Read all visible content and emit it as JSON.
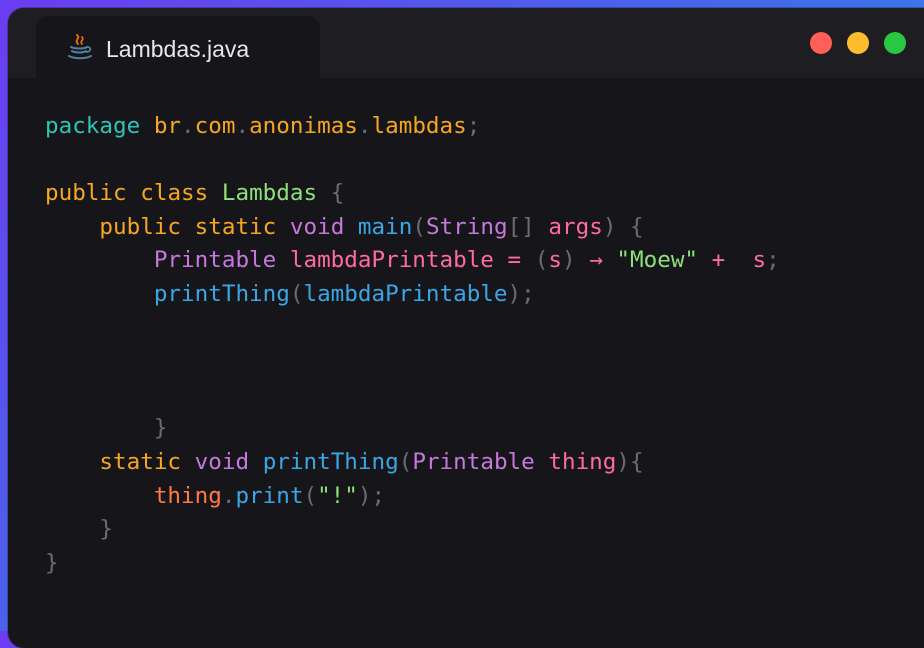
{
  "editor": {
    "tab": {
      "filename": "Lambdas.java",
      "icon": "java-icon"
    },
    "window_controls": [
      {
        "name": "close-dot",
        "color": "#ff5f57"
      },
      {
        "name": "minimize-dot",
        "color": "#febc2e"
      },
      {
        "name": "maximize-dot",
        "color": "#28c840"
      }
    ],
    "colors": {
      "background": "#16161a",
      "titlebar": "#1e1e22",
      "keyword": "#f5a623",
      "package_keyword": "#2ec4b6",
      "type": "#c678dd",
      "identifier": "#3aa6e6",
      "variable": "#ff6b9a",
      "string": "#8ee07a",
      "punctuation": "#6b6b75"
    },
    "code_lines": [
      [
        {
          "t": "package",
          "c": "#2ec4b6"
        },
        {
          "t": " ",
          "c": "#e4e4e7"
        },
        {
          "t": "br",
          "c": "#f5a623"
        },
        {
          "t": ".",
          "c": "#6b6b75"
        },
        {
          "t": "com",
          "c": "#f5a623"
        },
        {
          "t": ".",
          "c": "#6b6b75"
        },
        {
          "t": "anonimas",
          "c": "#f5a623"
        },
        {
          "t": ".",
          "c": "#6b6b75"
        },
        {
          "t": "lambdas",
          "c": "#f5a623"
        },
        {
          "t": ";",
          "c": "#6b6b75"
        }
      ],
      [],
      [
        {
          "t": "public",
          "c": "#f5a623"
        },
        {
          "t": " ",
          "c": "#e4e4e7"
        },
        {
          "t": "class",
          "c": "#f5a623"
        },
        {
          "t": " ",
          "c": "#e4e4e7"
        },
        {
          "t": "Lambdas",
          "c": "#8ee07a"
        },
        {
          "t": " ",
          "c": "#e4e4e7"
        },
        {
          "t": "{",
          "c": "#6b6b75"
        }
      ],
      [
        {
          "t": "    ",
          "c": "#e4e4e7"
        },
        {
          "t": "public",
          "c": "#f5a623"
        },
        {
          "t": " ",
          "c": "#e4e4e7"
        },
        {
          "t": "static",
          "c": "#f5a623"
        },
        {
          "t": " ",
          "c": "#e4e4e7"
        },
        {
          "t": "void",
          "c": "#c678dd"
        },
        {
          "t": " ",
          "c": "#e4e4e7"
        },
        {
          "t": "main",
          "c": "#3aa6e6"
        },
        {
          "t": "(",
          "c": "#6b6b75"
        },
        {
          "t": "String",
          "c": "#c678dd"
        },
        {
          "t": "[]",
          "c": "#6b6b75"
        },
        {
          "t": " ",
          "c": "#e4e4e7"
        },
        {
          "t": "args",
          "c": "#ff6b9a"
        },
        {
          "t": ")",
          "c": "#6b6b75"
        },
        {
          "t": " ",
          "c": "#e4e4e7"
        },
        {
          "t": "{",
          "c": "#6b6b75"
        }
      ],
      [
        {
          "t": "        ",
          "c": "#e4e4e7"
        },
        {
          "t": "Printable",
          "c": "#c678dd"
        },
        {
          "t": " ",
          "c": "#e4e4e7"
        },
        {
          "t": "lambdaPrintable",
          "c": "#ff6b9a"
        },
        {
          "t": " ",
          "c": "#e4e4e7"
        },
        {
          "t": "=",
          "c": "#ff6b9a"
        },
        {
          "t": " ",
          "c": "#e4e4e7"
        },
        {
          "t": "(",
          "c": "#6b6b75"
        },
        {
          "t": "s",
          "c": "#ff6b9a"
        },
        {
          "t": ")",
          "c": "#6b6b75"
        },
        {
          "t": " ",
          "c": "#e4e4e7"
        },
        {
          "t": "→",
          "c": "#ff6b9a"
        },
        {
          "t": " ",
          "c": "#e4e4e7"
        },
        {
          "t": "\"Moew\"",
          "c": "#8ee07a"
        },
        {
          "t": " ",
          "c": "#e4e4e7"
        },
        {
          "t": "+",
          "c": "#ff6b9a"
        },
        {
          "t": "  ",
          "c": "#e4e4e7"
        },
        {
          "t": "s",
          "c": "#ff6b9a"
        },
        {
          "t": ";",
          "c": "#6b6b75"
        }
      ],
      [
        {
          "t": "        ",
          "c": "#e4e4e7"
        },
        {
          "t": "printThing",
          "c": "#3aa6e6"
        },
        {
          "t": "(",
          "c": "#6b6b75"
        },
        {
          "t": "lambdaPrintable",
          "c": "#3aa6e6"
        },
        {
          "t": ")",
          "c": "#6b6b75"
        },
        {
          "t": ";",
          "c": "#6b6b75"
        }
      ],
      [],
      [],
      [],
      [
        {
          "t": "        ",
          "c": "#e4e4e7"
        },
        {
          "t": "}",
          "c": "#6b6b75"
        }
      ],
      [
        {
          "t": "    ",
          "c": "#e4e4e7"
        },
        {
          "t": "static",
          "c": "#f5a623"
        },
        {
          "t": " ",
          "c": "#e4e4e7"
        },
        {
          "t": "void",
          "c": "#c678dd"
        },
        {
          "t": " ",
          "c": "#e4e4e7"
        },
        {
          "t": "printThing",
          "c": "#3aa6e6"
        },
        {
          "t": "(",
          "c": "#6b6b75"
        },
        {
          "t": "Printable",
          "c": "#c678dd"
        },
        {
          "t": " ",
          "c": "#e4e4e7"
        },
        {
          "t": "thing",
          "c": "#ff6b9a"
        },
        {
          "t": ")",
          "c": "#6b6b75"
        },
        {
          "t": "{",
          "c": "#6b6b75"
        }
      ],
      [
        {
          "t": "        ",
          "c": "#e4e4e7"
        },
        {
          "t": "thing",
          "c": "#ff7a45"
        },
        {
          "t": ".",
          "c": "#6b6b75"
        },
        {
          "t": "print",
          "c": "#3aa6e6"
        },
        {
          "t": "(",
          "c": "#6b6b75"
        },
        {
          "t": "\"!\"",
          "c": "#8ee07a"
        },
        {
          "t": ")",
          "c": "#6b6b75"
        },
        {
          "t": ";",
          "c": "#6b6b75"
        }
      ],
      [
        {
          "t": "    ",
          "c": "#e4e4e7"
        },
        {
          "t": "}",
          "c": "#6b6b75"
        }
      ],
      [
        {
          "t": "}",
          "c": "#6b6b75"
        }
      ]
    ]
  }
}
